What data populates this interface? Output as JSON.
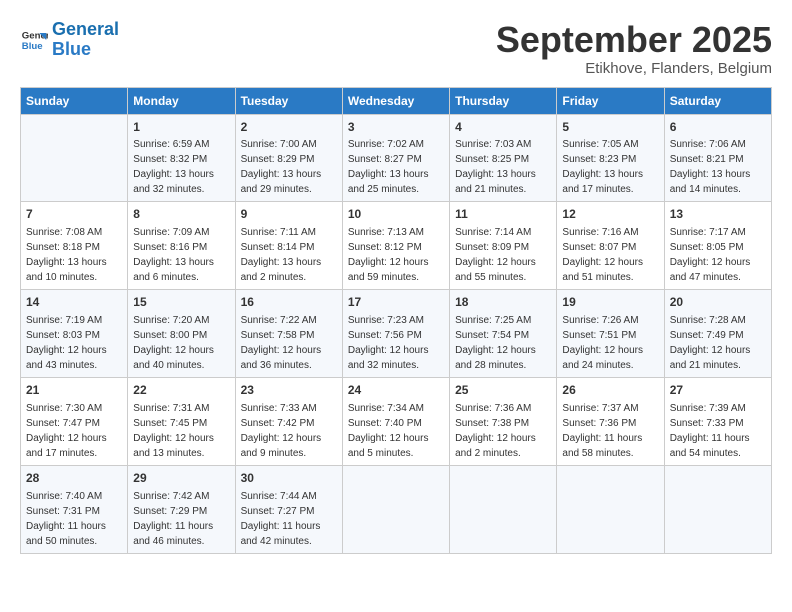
{
  "logo": {
    "line1": "General",
    "line2": "Blue"
  },
  "title": "September 2025",
  "subtitle": "Etikhove, Flanders, Belgium",
  "weekdays": [
    "Sunday",
    "Monday",
    "Tuesday",
    "Wednesday",
    "Thursday",
    "Friday",
    "Saturday"
  ],
  "weeks": [
    [
      {
        "day": "",
        "info": ""
      },
      {
        "day": "1",
        "info": "Sunrise: 6:59 AM\nSunset: 8:32 PM\nDaylight: 13 hours\nand 32 minutes."
      },
      {
        "day": "2",
        "info": "Sunrise: 7:00 AM\nSunset: 8:29 PM\nDaylight: 13 hours\nand 29 minutes."
      },
      {
        "day": "3",
        "info": "Sunrise: 7:02 AM\nSunset: 8:27 PM\nDaylight: 13 hours\nand 25 minutes."
      },
      {
        "day": "4",
        "info": "Sunrise: 7:03 AM\nSunset: 8:25 PM\nDaylight: 13 hours\nand 21 minutes."
      },
      {
        "day": "5",
        "info": "Sunrise: 7:05 AM\nSunset: 8:23 PM\nDaylight: 13 hours\nand 17 minutes."
      },
      {
        "day": "6",
        "info": "Sunrise: 7:06 AM\nSunset: 8:21 PM\nDaylight: 13 hours\nand 14 minutes."
      }
    ],
    [
      {
        "day": "7",
        "info": "Sunrise: 7:08 AM\nSunset: 8:18 PM\nDaylight: 13 hours\nand 10 minutes."
      },
      {
        "day": "8",
        "info": "Sunrise: 7:09 AM\nSunset: 8:16 PM\nDaylight: 13 hours\nand 6 minutes."
      },
      {
        "day": "9",
        "info": "Sunrise: 7:11 AM\nSunset: 8:14 PM\nDaylight: 13 hours\nand 2 minutes."
      },
      {
        "day": "10",
        "info": "Sunrise: 7:13 AM\nSunset: 8:12 PM\nDaylight: 12 hours\nand 59 minutes."
      },
      {
        "day": "11",
        "info": "Sunrise: 7:14 AM\nSunset: 8:09 PM\nDaylight: 12 hours\nand 55 minutes."
      },
      {
        "day": "12",
        "info": "Sunrise: 7:16 AM\nSunset: 8:07 PM\nDaylight: 12 hours\nand 51 minutes."
      },
      {
        "day": "13",
        "info": "Sunrise: 7:17 AM\nSunset: 8:05 PM\nDaylight: 12 hours\nand 47 minutes."
      }
    ],
    [
      {
        "day": "14",
        "info": "Sunrise: 7:19 AM\nSunset: 8:03 PM\nDaylight: 12 hours\nand 43 minutes."
      },
      {
        "day": "15",
        "info": "Sunrise: 7:20 AM\nSunset: 8:00 PM\nDaylight: 12 hours\nand 40 minutes."
      },
      {
        "day": "16",
        "info": "Sunrise: 7:22 AM\nSunset: 7:58 PM\nDaylight: 12 hours\nand 36 minutes."
      },
      {
        "day": "17",
        "info": "Sunrise: 7:23 AM\nSunset: 7:56 PM\nDaylight: 12 hours\nand 32 minutes."
      },
      {
        "day": "18",
        "info": "Sunrise: 7:25 AM\nSunset: 7:54 PM\nDaylight: 12 hours\nand 28 minutes."
      },
      {
        "day": "19",
        "info": "Sunrise: 7:26 AM\nSunset: 7:51 PM\nDaylight: 12 hours\nand 24 minutes."
      },
      {
        "day": "20",
        "info": "Sunrise: 7:28 AM\nSunset: 7:49 PM\nDaylight: 12 hours\nand 21 minutes."
      }
    ],
    [
      {
        "day": "21",
        "info": "Sunrise: 7:30 AM\nSunset: 7:47 PM\nDaylight: 12 hours\nand 17 minutes."
      },
      {
        "day": "22",
        "info": "Sunrise: 7:31 AM\nSunset: 7:45 PM\nDaylight: 12 hours\nand 13 minutes."
      },
      {
        "day": "23",
        "info": "Sunrise: 7:33 AM\nSunset: 7:42 PM\nDaylight: 12 hours\nand 9 minutes."
      },
      {
        "day": "24",
        "info": "Sunrise: 7:34 AM\nSunset: 7:40 PM\nDaylight: 12 hours\nand 5 minutes."
      },
      {
        "day": "25",
        "info": "Sunrise: 7:36 AM\nSunset: 7:38 PM\nDaylight: 12 hours\nand 2 minutes."
      },
      {
        "day": "26",
        "info": "Sunrise: 7:37 AM\nSunset: 7:36 PM\nDaylight: 11 hours\nand 58 minutes."
      },
      {
        "day": "27",
        "info": "Sunrise: 7:39 AM\nSunset: 7:33 PM\nDaylight: 11 hours\nand 54 minutes."
      }
    ],
    [
      {
        "day": "28",
        "info": "Sunrise: 7:40 AM\nSunset: 7:31 PM\nDaylight: 11 hours\nand 50 minutes."
      },
      {
        "day": "29",
        "info": "Sunrise: 7:42 AM\nSunset: 7:29 PM\nDaylight: 11 hours\nand 46 minutes."
      },
      {
        "day": "30",
        "info": "Sunrise: 7:44 AM\nSunset: 7:27 PM\nDaylight: 11 hours\nand 42 minutes."
      },
      {
        "day": "",
        "info": ""
      },
      {
        "day": "",
        "info": ""
      },
      {
        "day": "",
        "info": ""
      },
      {
        "day": "",
        "info": ""
      }
    ]
  ]
}
